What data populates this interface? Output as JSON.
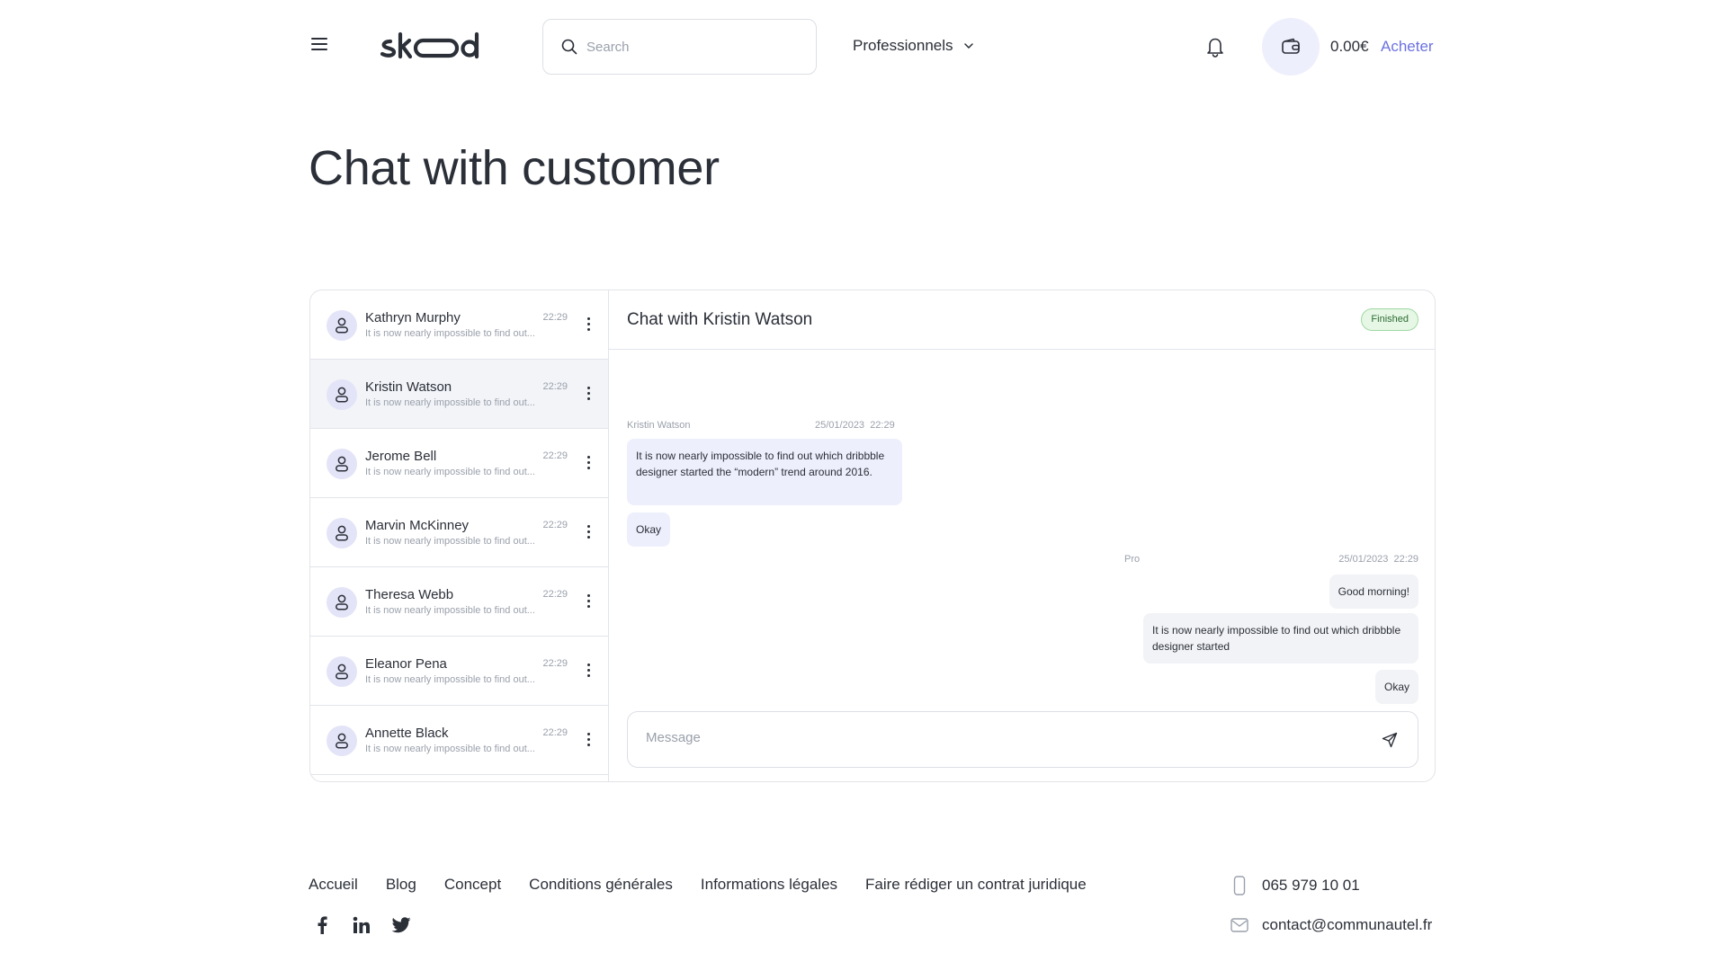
{
  "header": {
    "brand": "skood",
    "search_placeholder": "Search",
    "dropdown_label": "Professionnels",
    "balance": "0.00€",
    "buy_label": "Acheter"
  },
  "page": {
    "title": "Chat with customer"
  },
  "conversations": [
    {
      "name": "Kathryn Murphy",
      "time": "22:29",
      "preview": "It is now nearly impossible to find out...",
      "active": false
    },
    {
      "name": "Kristin Watson",
      "time": "22:29",
      "preview": "It is now nearly impossible to find out...",
      "active": true
    },
    {
      "name": "Jerome Bell",
      "time": "22:29",
      "preview": "It is now nearly impossible to find out...",
      "active": false
    },
    {
      "name": "Marvin McKinney",
      "time": "22:29",
      "preview": "It is now nearly impossible to find out...",
      "active": false
    },
    {
      "name": "Theresa Webb",
      "time": "22:29",
      "preview": "It is now nearly impossible to find out...",
      "active": false
    },
    {
      "name": "Eleanor Pena",
      "time": "22:29",
      "preview": "It is now nearly impossible to find out...",
      "active": false
    },
    {
      "name": "Annette Black",
      "time": "22:29",
      "preview": "It is now nearly impossible to find out...",
      "active": false
    }
  ],
  "chat": {
    "title": "Chat with Kristin Watson",
    "status": "Finished",
    "incoming": {
      "sender": "Kristin Watson",
      "date": "25/01/2023",
      "time": "22:29",
      "messages": [
        "It is now nearly impossible to find out which dribbble designer started the “modern” trend around 2016.",
        "Okay"
      ]
    },
    "outgoing": {
      "sender": "Pro",
      "date": "25/01/2023",
      "time": "22:29",
      "messages": [
        "Good morning!",
        "It is now nearly impossible to find out which dribbble designer started",
        "Okay"
      ]
    },
    "composer_placeholder": "Message"
  },
  "footer": {
    "links": [
      "Accueil",
      "Blog",
      "Concept",
      "Conditions générales",
      "Informations légales",
      "Faire rédiger un contrat juridique"
    ],
    "social": [
      "facebook-icon",
      "linkedin-icon",
      "twitter-icon"
    ],
    "phone": "065 979 10 01",
    "email": "contact@communautel.fr"
  },
  "colors": {
    "accent": "#6c72e0",
    "bubble_in": "#eeeffc",
    "bubble_out": "#f2f3f6",
    "status_green": "#e6f7e6"
  }
}
